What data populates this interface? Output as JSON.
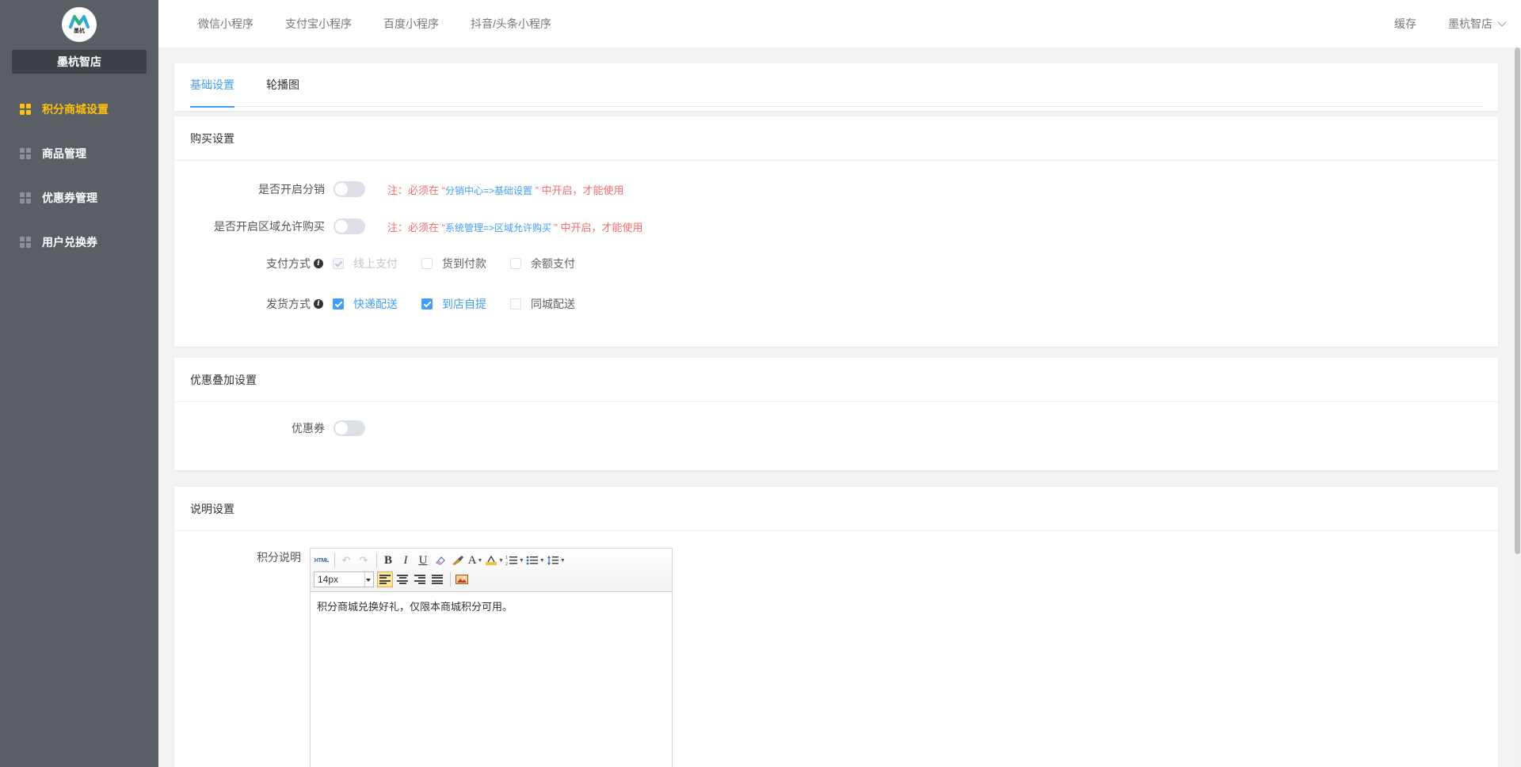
{
  "app": {
    "logo_text": "墨杭",
    "shop_name": "墨杭智店"
  },
  "sidebar": {
    "items": [
      {
        "label": "积分商城设置",
        "active": true
      },
      {
        "label": "商品管理",
        "active": false
      },
      {
        "label": "优惠券管理",
        "active": false
      },
      {
        "label": "用户兑换券",
        "active": false
      }
    ]
  },
  "topbar": {
    "tabs": [
      "微信小程序",
      "支付宝小程序",
      "百度小程序",
      "抖音/头条小程序"
    ],
    "cache": "缓存",
    "user": "墨杭智店"
  },
  "page_tabs": [
    {
      "label": "基础设置",
      "active": true
    },
    {
      "label": "轮播图",
      "active": false
    }
  ],
  "buy": {
    "title": "购买设置",
    "distribution": {
      "label": "是否开启分销",
      "enabled": false,
      "note_prefix": "注：必须在 “",
      "note_link": "分销中心=>基础设置",
      "note_suffix": " ” 中开启，才能使用"
    },
    "region": {
      "label": "是否开启区域允许购买",
      "enabled": false,
      "note_prefix": "注：必须在 “",
      "note_link": "系统管理=>区域允许购买",
      "note_suffix": " ” 中开启，才能使用"
    },
    "payment": {
      "label": "支付方式",
      "info_icon": "info-icon",
      "options": [
        {
          "label": "线上支付",
          "checked": true,
          "disabled": true
        },
        {
          "label": "货到付款",
          "checked": false,
          "disabled": false
        },
        {
          "label": "余额支付",
          "checked": false,
          "disabled": false
        }
      ]
    },
    "delivery": {
      "label": "发货方式",
      "info_icon": "info-icon",
      "options": [
        {
          "label": "快递配送",
          "checked": true,
          "disabled": false
        },
        {
          "label": "到店自提",
          "checked": true,
          "disabled": false
        },
        {
          "label": "同城配送",
          "checked": false,
          "disabled": false
        }
      ]
    }
  },
  "stack": {
    "title": "优惠叠加设置",
    "coupon": {
      "label": "优惠券",
      "enabled": false
    }
  },
  "desc": {
    "title": "说明设置",
    "points_label": "积分说明",
    "editor": {
      "html_btn": "HTML",
      "font_size": "14px",
      "content": "积分商城兑换好礼，仅限本商城积分可用。"
    }
  },
  "colors": {
    "sidebar_bg": "#5a5f66",
    "active_nav": "#ffc107",
    "primary": "#409eff",
    "note_red": "#f56c6c"
  }
}
